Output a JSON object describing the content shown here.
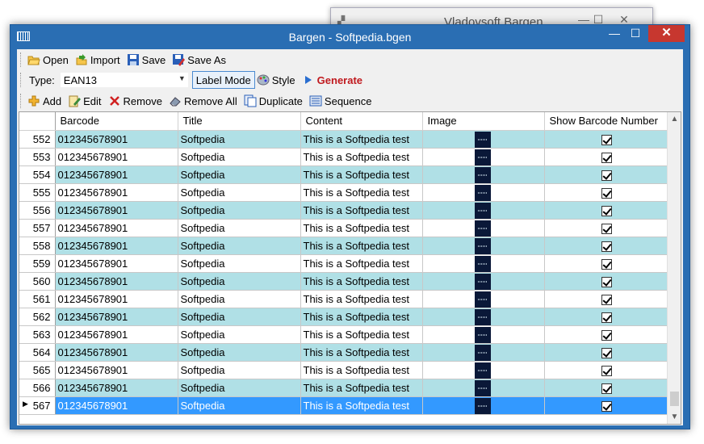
{
  "background_window": {
    "title": "Vladovsoft Bargen"
  },
  "window": {
    "title": "Bargen - Softpedia.bgen",
    "minimize": "—",
    "maximize": "☐",
    "close": "✕"
  },
  "toolbar1": {
    "open": "Open",
    "import": "Import",
    "save": "Save",
    "save_as": "Save As"
  },
  "toolbar2": {
    "type_label": "Type:",
    "type_value": "EAN13",
    "label_mode": "Label Mode",
    "style": "Style",
    "generate": "Generate"
  },
  "toolbar3": {
    "add": "Add",
    "edit": "Edit",
    "remove": "Remove",
    "remove_all": "Remove All",
    "duplicate": "Duplicate",
    "sequence": "Sequence"
  },
  "grid": {
    "columns": [
      "Barcode",
      "Title",
      "Content",
      "Image",
      "Show Barcode Number"
    ],
    "rows": [
      {
        "num": "552",
        "barcode": "012345678901",
        "title": "Softpedia",
        "content": "This is a Softpedia test",
        "checked": true
      },
      {
        "num": "553",
        "barcode": "012345678901",
        "title": "Softpedia",
        "content": "This is a Softpedia test",
        "checked": true
      },
      {
        "num": "554",
        "barcode": "012345678901",
        "title": "Softpedia",
        "content": "This is a Softpedia test",
        "checked": true
      },
      {
        "num": "555",
        "barcode": "012345678901",
        "title": "Softpedia",
        "content": "This is a Softpedia test",
        "checked": true
      },
      {
        "num": "556",
        "barcode": "012345678901",
        "title": "Softpedia",
        "content": "This is a Softpedia test",
        "checked": true
      },
      {
        "num": "557",
        "barcode": "012345678901",
        "title": "Softpedia",
        "content": "This is a Softpedia test",
        "checked": true
      },
      {
        "num": "558",
        "barcode": "012345678901",
        "title": "Softpedia",
        "content": "This is a Softpedia test",
        "checked": true
      },
      {
        "num": "559",
        "barcode": "012345678901",
        "title": "Softpedia",
        "content": "This is a Softpedia test",
        "checked": true
      },
      {
        "num": "560",
        "barcode": "012345678901",
        "title": "Softpedia",
        "content": "This is a Softpedia test",
        "checked": true
      },
      {
        "num": "561",
        "barcode": "012345678901",
        "title": "Softpedia",
        "content": "This is a Softpedia test",
        "checked": true
      },
      {
        "num": "562",
        "barcode": "012345678901",
        "title": "Softpedia",
        "content": "This is a Softpedia test",
        "checked": true
      },
      {
        "num": "563",
        "barcode": "012345678901",
        "title": "Softpedia",
        "content": "This is a Softpedia test",
        "checked": true
      },
      {
        "num": "564",
        "barcode": "012345678901",
        "title": "Softpedia",
        "content": "This is a Softpedia test",
        "checked": true
      },
      {
        "num": "565",
        "barcode": "012345678901",
        "title": "Softpedia",
        "content": "This is a Softpedia test",
        "checked": true
      },
      {
        "num": "566",
        "barcode": "012345678901",
        "title": "Softpedia",
        "content": "This is a Softpedia test",
        "checked": true
      },
      {
        "num": "567",
        "barcode": "012345678901",
        "title": "Softpedia",
        "content": "This is a Softpedia test",
        "checked": true,
        "selected": true
      }
    ]
  },
  "colors": {
    "title_bar": "#2a6eb3",
    "close_button": "#c7372f",
    "row_alt": "#b0e0e6",
    "row_selected": "#3399ff",
    "generate_text": "#c0191e"
  }
}
